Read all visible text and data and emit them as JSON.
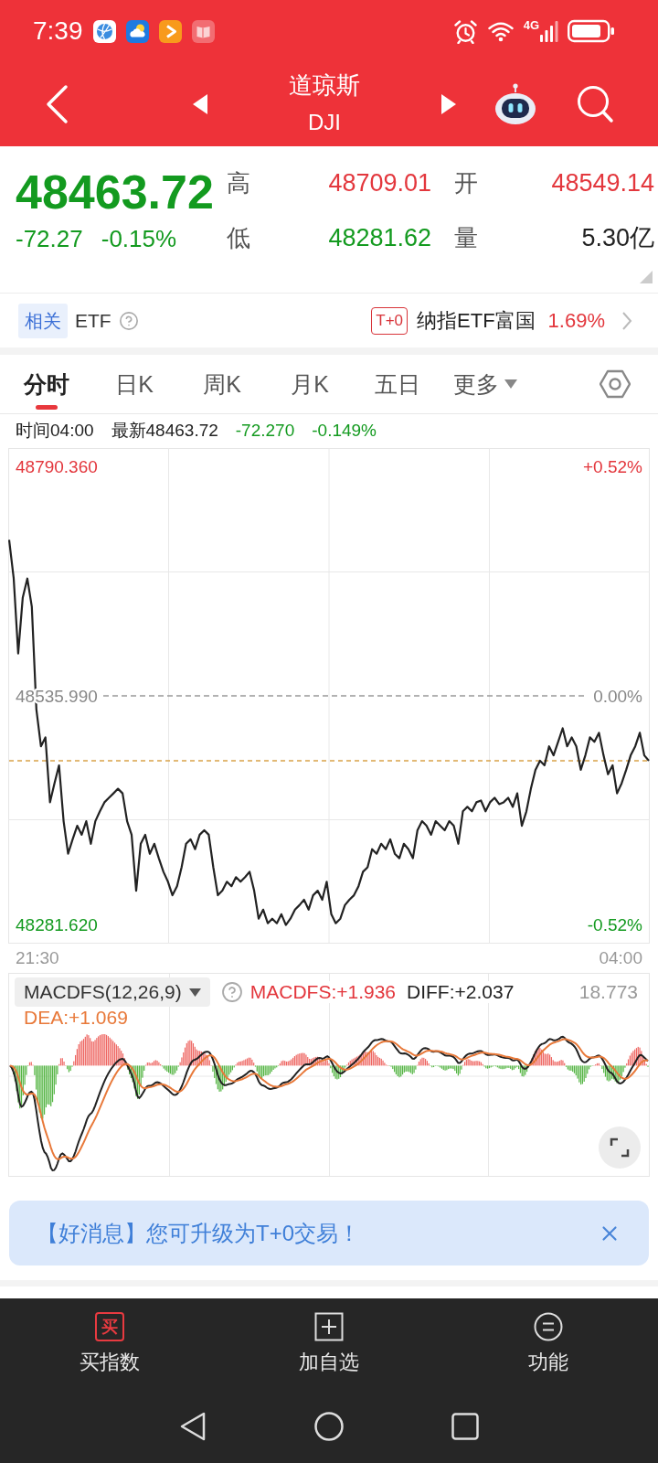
{
  "status_bar": {
    "time": "7:39",
    "network": "4G"
  },
  "header": {
    "title": "道琼斯",
    "subtitle": "DJI"
  },
  "quote": {
    "price": "48463.72",
    "change": "-72.27",
    "change_pct": "-0.15%",
    "falling": true,
    "stats": [
      {
        "label": "高",
        "value": "48709.01",
        "color": "#e3373d"
      },
      {
        "label": "开",
        "value": "48549.14",
        "color": "#e3373d"
      },
      {
        "label": "低",
        "value": "48281.62",
        "color": "#139a1f"
      },
      {
        "label": "量",
        "value": "5.30亿",
        "color": "#222222"
      }
    ]
  },
  "related": {
    "tag": "相关",
    "title": "ETF",
    "fund_tag": "T+0",
    "fund_name": "纳指ETF富国",
    "fund_change": "1.69%",
    "fund_falling": false
  },
  "tabs": [
    {
      "label": "分时",
      "selected": true,
      "kind": "plain"
    },
    {
      "label": "日K",
      "selected": false,
      "kind": "plain"
    },
    {
      "label": "周K",
      "selected": false,
      "kind": "plain"
    },
    {
      "label": "月K",
      "selected": false,
      "kind": "plain"
    },
    {
      "label": "五日",
      "selected": false,
      "kind": "plain"
    },
    {
      "label": "更多",
      "selected": false,
      "kind": "dropdown"
    }
  ],
  "info_line": {
    "time": "时间04:00",
    "latest": "最新48463.72",
    "change": "-72.270",
    "change_pct": "-0.149%",
    "falling": true
  },
  "price_chart": {
    "percent_ticks": [
      "+0.52%",
      "0.00%",
      "-0.52%"
    ],
    "time_axis": [
      "21:30",
      "04:00"
    ],
    "chart_data": {
      "type": "line",
      "series": [
        {
          "color": "#222222",
          "values": [
            48709,
            48666,
            48583,
            48645,
            48666,
            48635,
            48521,
            48480,
            48490,
            48418,
            48439,
            48459,
            48397,
            48361,
            48377,
            48392,
            48382,
            48397,
            48372,
            48397,
            48408,
            48418,
            48423,
            48428,
            48433,
            48428,
            48397,
            48382,
            48320,
            48372,
            48382,
            48361,
            48372,
            48356,
            48341,
            48330,
            48315,
            48325,
            48346,
            48372,
            48377,
            48366,
            48382,
            48387,
            48382,
            48346,
            48315,
            48320,
            48330,
            48325,
            48335,
            48330,
            48335,
            48341,
            48320,
            48289,
            48299,
            48284,
            48289,
            48284,
            48294,
            48282,
            48289,
            48299,
            48304,
            48310,
            48299,
            48315,
            48320,
            48310,
            48330,
            48294,
            48284,
            48289,
            48304,
            48310,
            48315,
            48325,
            48341,
            48346,
            48366,
            48361,
            48372,
            48366,
            48377,
            48361,
            48356,
            48372,
            48366,
            48356,
            48387,
            48397,
            48392,
            48382,
            48397,
            48392,
            48387,
            48397,
            48392,
            48372,
            48408,
            48413,
            48408,
            48418,
            48420,
            48408,
            48418,
            48423,
            48416,
            48418,
            48423,
            48413,
            48428,
            48392,
            48408,
            48433,
            48454,
            48464,
            48459,
            48480,
            48470,
            48485,
            48500,
            48480,
            48490,
            48480,
            48454,
            48470,
            48490,
            48485,
            48495,
            48470,
            48449,
            48459,
            48428,
            48439,
            48454,
            48470,
            48480,
            48495,
            48470,
            48464
          ]
        }
      ],
      "ylim": [
        48261.35,
        48810.63
      ],
      "yticks": [
        {
          "value": 48790.36,
          "label": "48790.360"
        },
        {
          "value": 48535.99,
          "label": "48535.990"
        },
        {
          "value": 48281.62,
          "label": "48281.620"
        }
      ],
      "ref_lines": [
        {
          "axis": "y",
          "value": 48535.99,
          "color": "#999999"
        },
        {
          "axis": "y",
          "value": 48464,
          "color": "#d9a24a"
        }
      ]
    }
  },
  "macd": {
    "selector": "MACDFS(12,26,9)",
    "readings": [
      {
        "text": "MACDFS:+1.936",
        "color": "#e3373d"
      },
      {
        "text": "DIFF:+2.037",
        "color": "#222222"
      },
      {
        "text": "DEA:+1.069",
        "color": "#e8793a"
      }
    ],
    "max_label": "18.773"
  },
  "banner": {
    "text": "【好消息】您可升级为T+0交易！"
  },
  "bottom_nav": [
    {
      "label": "买指数",
      "kind": "buy",
      "badge": "买"
    },
    {
      "label": "加自选",
      "kind": "add"
    },
    {
      "label": "功能",
      "kind": "menu"
    }
  ]
}
